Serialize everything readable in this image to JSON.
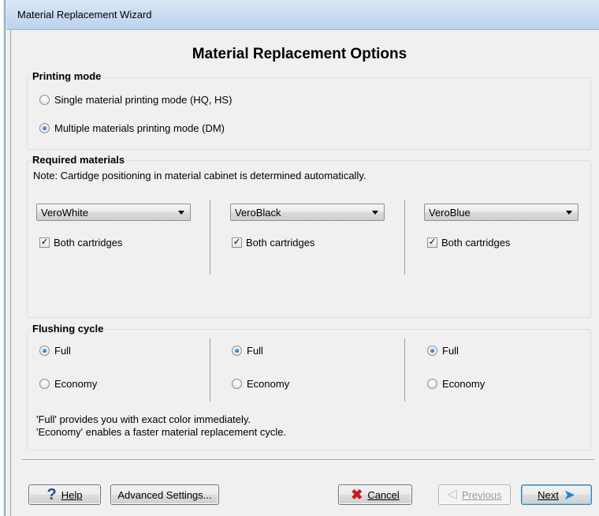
{
  "window": {
    "title": "Material Replacement Wizard"
  },
  "page": {
    "heading": "Material Replacement Options"
  },
  "printing_mode": {
    "label": "Printing mode",
    "options": [
      {
        "label": "Single material printing mode (HQ, HS)",
        "selected": false
      },
      {
        "label": "Multiple materials printing mode (DM)",
        "selected": true
      }
    ]
  },
  "required_materials": {
    "label": "Required materials",
    "note": "Note: Cartidge positioning in material cabinet is determined automatically.",
    "columns": [
      {
        "material": "VeroWhite",
        "both_cartridges_label": "Both cartridges",
        "both_cartridges_checked": true
      },
      {
        "material": "VeroBlack",
        "both_cartridges_label": "Both cartridges",
        "both_cartridges_checked": true
      },
      {
        "material": "VeroBlue",
        "both_cartridges_label": "Both cartridges",
        "both_cartridges_checked": true
      }
    ]
  },
  "flushing_cycle": {
    "label": "Flushing cycle",
    "columns": [
      {
        "full_label": "Full",
        "economy_label": "Economy",
        "selected": "Full"
      },
      {
        "full_label": "Full",
        "economy_label": "Economy",
        "selected": "Full"
      },
      {
        "full_label": "Full",
        "economy_label": "Economy",
        "selected": "Full"
      }
    ],
    "note_line1": "'Full' provides you with exact color immediately.",
    "note_line2": "'Economy' enables a faster material replacement cycle."
  },
  "buttons": {
    "help": {
      "label": "Help",
      "icon": "question-icon"
    },
    "advanced": {
      "label": "Advanced Settings..."
    },
    "cancel": {
      "label": "Cancel",
      "icon": "x-icon"
    },
    "previous": {
      "label": "Previous",
      "icon": "arrow-left-icon",
      "enabled": false
    },
    "next": {
      "label": "Next",
      "icon": "arrow-right-icon"
    }
  },
  "colors": {
    "cancel_icon": "#d2161b",
    "next_icon": "#1e86d8",
    "help_icon": "#1f4f93",
    "title_bar": "#c9dcf1"
  }
}
